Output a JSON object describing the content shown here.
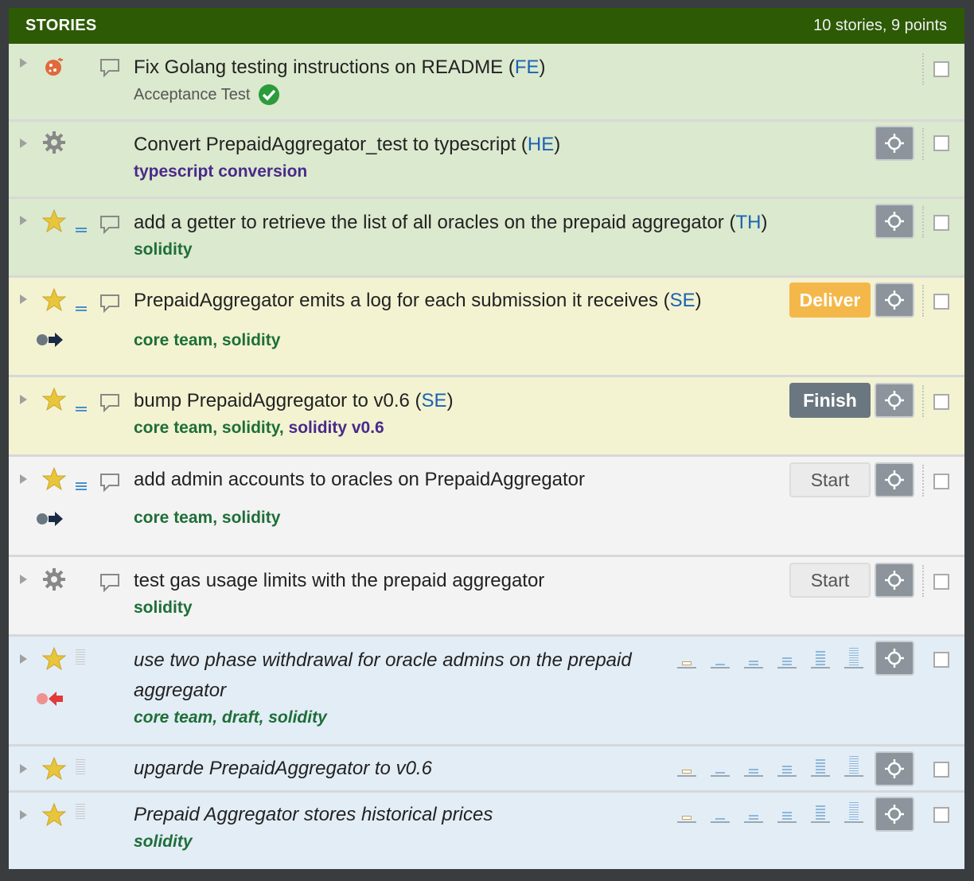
{
  "header": {
    "title": "STORIES",
    "count": "10 stories, 9 points"
  },
  "stories": [
    {
      "name": "Fix Golang testing instructions on README (",
      "owner": "FE",
      "suffix": ")",
      "type": "bug",
      "state": "accepted",
      "sub": "Acceptance Test"
    },
    {
      "name": "Convert PrepaidAggregator_test to typescript (",
      "owner": "HE",
      "suffix": ")",
      "type": "chore",
      "state": "accepted",
      "labels": [
        "typescript conversion"
      ]
    },
    {
      "name": "add a getter to retrieve the list of all oracles on the prepaid aggregator (",
      "owner": "TH",
      "suffix": ")",
      "type": "feature",
      "state": "accepted",
      "labels": [
        "solidity"
      ]
    },
    {
      "name": "PrepaidAggregator emits a log for each submission it receives (",
      "owner": "SE",
      "suffix": ")",
      "type": "feature",
      "state": "finished",
      "button": "Deliver",
      "labels": [
        "core team",
        "solidity"
      ]
    },
    {
      "name": "bump PrepaidAggregator to v0.6 (",
      "owner": "SE",
      "suffix": ")",
      "type": "feature",
      "state": "started",
      "button": "Finish",
      "labels": [
        "core team",
        "solidity",
        "solidity v0.6"
      ]
    },
    {
      "name": "add admin accounts to oracles on PrepaidAggregator",
      "type": "feature",
      "state": "unstarted",
      "button": "Start",
      "labels": [
        "core team",
        "solidity"
      ]
    },
    {
      "name": "test gas usage limits with the prepaid aggregator",
      "type": "chore",
      "state": "unstarted",
      "button": "Start",
      "labels": [
        "solidity"
      ]
    },
    {
      "name": "use two phase withdrawal for oracle admins on the prepaid",
      "name2": "aggregator",
      "type": "feature",
      "state": "unscheduled",
      "labels": [
        "core team",
        "draft",
        "solidity"
      ]
    },
    {
      "name": "upgarde PrepaidAggregator to v0.6",
      "type": "feature",
      "state": "unscheduled"
    },
    {
      "name": "Prepaid Aggregator stores historical prices",
      "type": "feature",
      "state": "unscheduled",
      "labels": [
        "solidity"
      ]
    }
  ],
  "separator": ", ",
  "colors": {
    "header": "#2d5a05",
    "accepted": "#dbe9ce",
    "delivered": "#f3f3d2",
    "icebox": "#e3edf6",
    "owner": "#1b63b1",
    "label": "#1e6e38"
  }
}
